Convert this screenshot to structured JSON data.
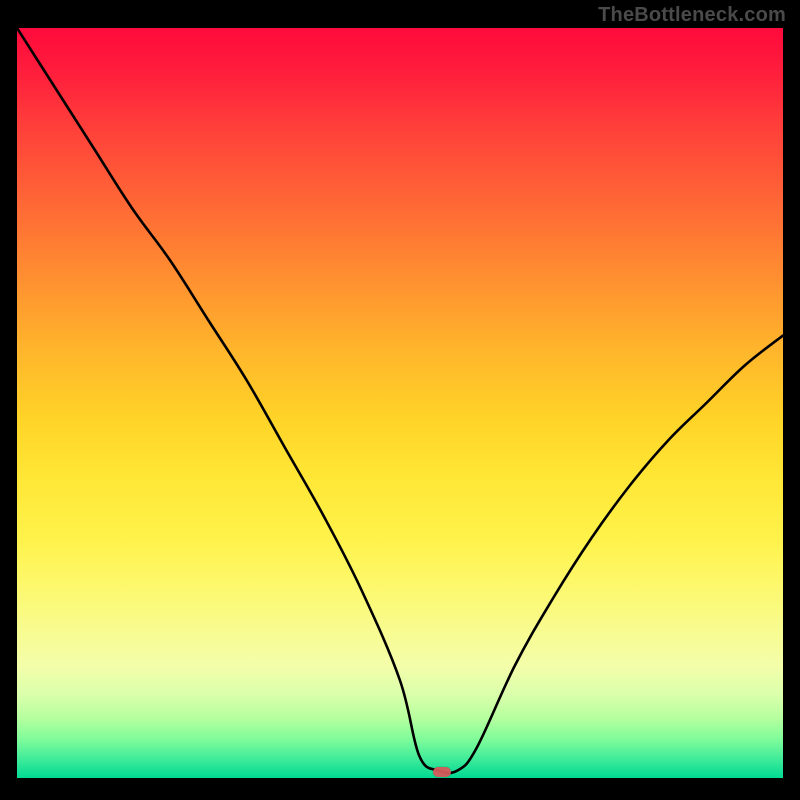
{
  "watermark": "TheBottleneck.com",
  "marker": {
    "x_frac": 0.555,
    "y_frac": 0.992
  },
  "chart_data": {
    "type": "line",
    "title": "",
    "xlabel": "",
    "ylabel": "",
    "xlim": [
      0,
      1
    ],
    "ylim": [
      0,
      1
    ],
    "series": [
      {
        "name": "curve",
        "x": [
          0.0,
          0.05,
          0.1,
          0.15,
          0.2,
          0.25,
          0.3,
          0.35,
          0.4,
          0.45,
          0.5,
          0.525,
          0.55,
          0.575,
          0.6,
          0.65,
          0.7,
          0.75,
          0.8,
          0.85,
          0.9,
          0.95,
          1.0
        ],
        "y": [
          1.0,
          0.92,
          0.84,
          0.76,
          0.69,
          0.61,
          0.53,
          0.44,
          0.35,
          0.25,
          0.13,
          0.03,
          0.01,
          0.01,
          0.04,
          0.15,
          0.24,
          0.32,
          0.39,
          0.45,
          0.5,
          0.55,
          0.59
        ]
      }
    ],
    "annotations": [
      {
        "type": "marker",
        "x": 0.555,
        "y": 0.008,
        "shape": "pill",
        "color": "#d65a5a"
      }
    ],
    "background_gradient": {
      "direction": "vertical",
      "stops": [
        {
          "pos": 0.0,
          "color": "#ff0a3c"
        },
        {
          "pos": 0.5,
          "color": "#ffd327"
        },
        {
          "pos": 0.85,
          "color": "#f4feaa"
        },
        {
          "pos": 1.0,
          "color": "#00d992"
        }
      ]
    }
  }
}
